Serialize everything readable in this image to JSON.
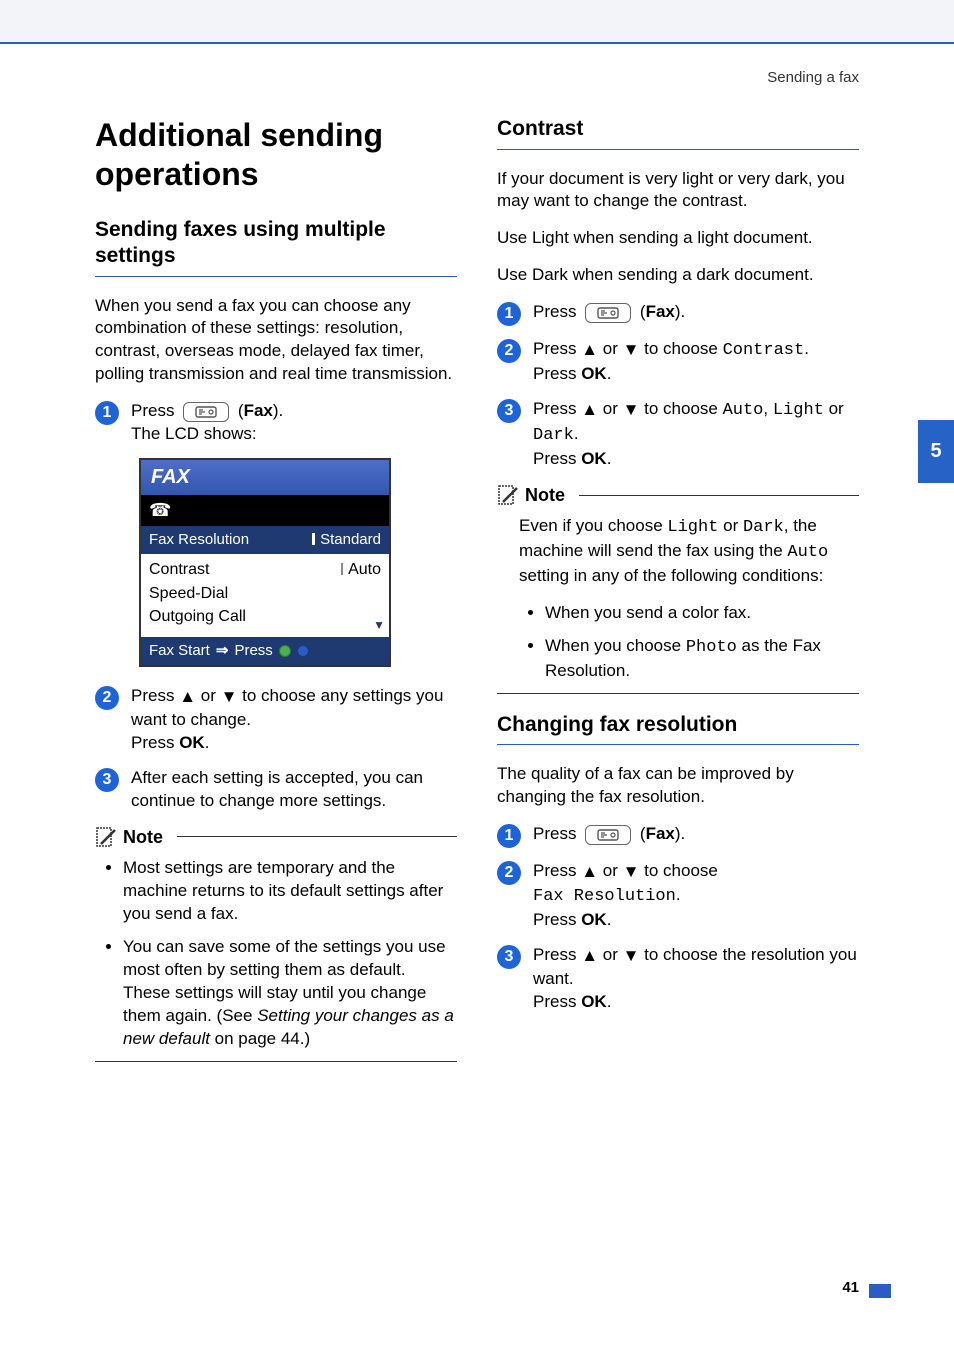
{
  "header": {
    "section": "Sending a fax"
  },
  "chapterTab": "5",
  "pageNumber": "41",
  "left": {
    "h1": "Additional sending operations",
    "h2": "Sending faxes using multiple settings",
    "intro": "When you send a fax you can choose any combination of these settings: resolution, contrast, overseas mode, delayed fax timer, polling transmission and real time transmission.",
    "step1_press": "Press ",
    "step1_faxLabel": "Fax",
    "step1_tail": ").",
    "step1_lcd": "The LCD shows:",
    "lcd": {
      "title": "FAX",
      "headerRow": {
        "label": "Fax Resolution",
        "value": "Standard"
      },
      "row1": {
        "label": "Contrast",
        "value": "Auto"
      },
      "row2": {
        "label": "Speed-Dial",
        "value": ""
      },
      "row3": {
        "label": "Outgoing Call",
        "value": ""
      },
      "footer_a": "Fax Start",
      "footer_b": "Press"
    },
    "step2_a": "Press ",
    "step2_b": " or ",
    "step2_c": " to choose any settings you want to change.",
    "step2_d": "Press ",
    "step2_ok": "OK",
    "step2_e": ".",
    "step3": "After each setting is accepted, you can continue to change more settings.",
    "noteLabel": "Note",
    "note_b1": "Most settings are temporary and the machine returns to its default settings after you send a fax.",
    "note_b2_a": "You can save some of the settings you use most often by setting them as default. These settings will stay until you change them again. (See ",
    "note_b2_ref": "Setting your changes as a new default",
    "note_b2_b": " on page 44.)"
  },
  "right": {
    "sec1": {
      "h2": "Contrast",
      "p1": "If your document is very light or very dark, you may want to change the contrast.",
      "p2": "Use Light when sending a light document.",
      "p3": "Use Dark when sending a dark document.",
      "s1_press": "Press ",
      "s1_fax": "Fax",
      "s1_tail": ").",
      "s2_a": "Press ",
      "s2_b": " or ",
      "s2_c": " to choose ",
      "s2_mono": "Contrast",
      "s2_d": ".",
      "s2_e": "Press ",
      "s2_ok": "OK",
      "s2_f": ".",
      "s3_a": "Press ",
      "s3_b": " or ",
      "s3_c": " to choose ",
      "s3_m1": "Auto",
      "s3_sep1": ", ",
      "s3_m2": "Light",
      "s3_or": " or ",
      "s3_m3": "Dark",
      "s3_d": ".",
      "s3_e": "Press ",
      "s3_ok": "OK",
      "s3_f": ".",
      "noteLabel": "Note",
      "note_p_a": "Even if you choose ",
      "note_m1": "Light",
      "note_p_b": " or ",
      "note_m2": "Dark",
      "note_p_c": ", the machine will send the fax using the ",
      "note_m3": "Auto",
      "note_p_d": " setting in any of the following conditions:",
      "note_li1": "When you send a color fax.",
      "note_li2_a": "When you choose ",
      "note_li2_m": "Photo",
      "note_li2_b": " as the Fax Resolution."
    },
    "sec2": {
      "h2": "Changing fax resolution",
      "p1": "The quality of a fax can be improved by changing the fax resolution.",
      "s1_press": "Press ",
      "s1_fax": "Fax",
      "s1_tail": ").",
      "s2_a": "Press ",
      "s2_b": " or ",
      "s2_c": " to choose ",
      "s2_mono": "Fax Resolution",
      "s2_d": ".",
      "s2_e": "Press ",
      "s2_ok": "OK",
      "s2_f": ".",
      "s3_a": "Press ",
      "s3_b": " or ",
      "s3_c": " to choose the resolution you want.",
      "s3_e": "Press ",
      "s3_ok": "OK",
      "s3_f": "."
    }
  }
}
